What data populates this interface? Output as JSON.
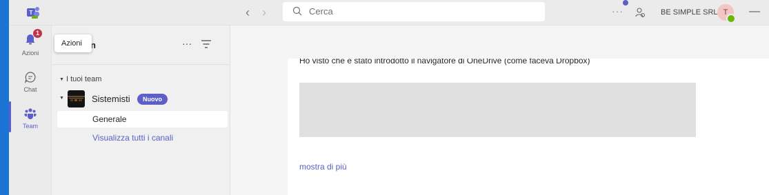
{
  "window": {
    "search_placeholder": "Cerca",
    "org_name": "BE SIMPLE SRL",
    "avatar_initial": "T",
    "more_label": "···",
    "minimize_label": "—"
  },
  "rail": {
    "items": [
      {
        "label": "Azioni",
        "icon": "bell-icon",
        "badge": "1"
      },
      {
        "label": "Chat",
        "icon": "chat-icon"
      },
      {
        "label": "Team",
        "icon": "teams-icon"
      }
    ]
  },
  "tooltip": {
    "text": "Azioni"
  },
  "teams_panel": {
    "header_fragment": "n",
    "more_label": "···",
    "section_label": "I tuoi team",
    "team": {
      "name": "Sistemisti",
      "badge": "Nuovo"
    },
    "selected_channel": "Generale",
    "see_all_link": "Visualizza tutti i canali"
  },
  "main": {
    "clipped_text": "Ho visto che è stato introdotto il navigatore di OneDrive (come faceva Dropbox)",
    "show_more_link": "mostra di più"
  },
  "colors": {
    "accent": "#5b5fc7",
    "badge_red": "#c4314b",
    "presence_green": "#6bb700",
    "desktop_blue": "#1b73d4"
  }
}
